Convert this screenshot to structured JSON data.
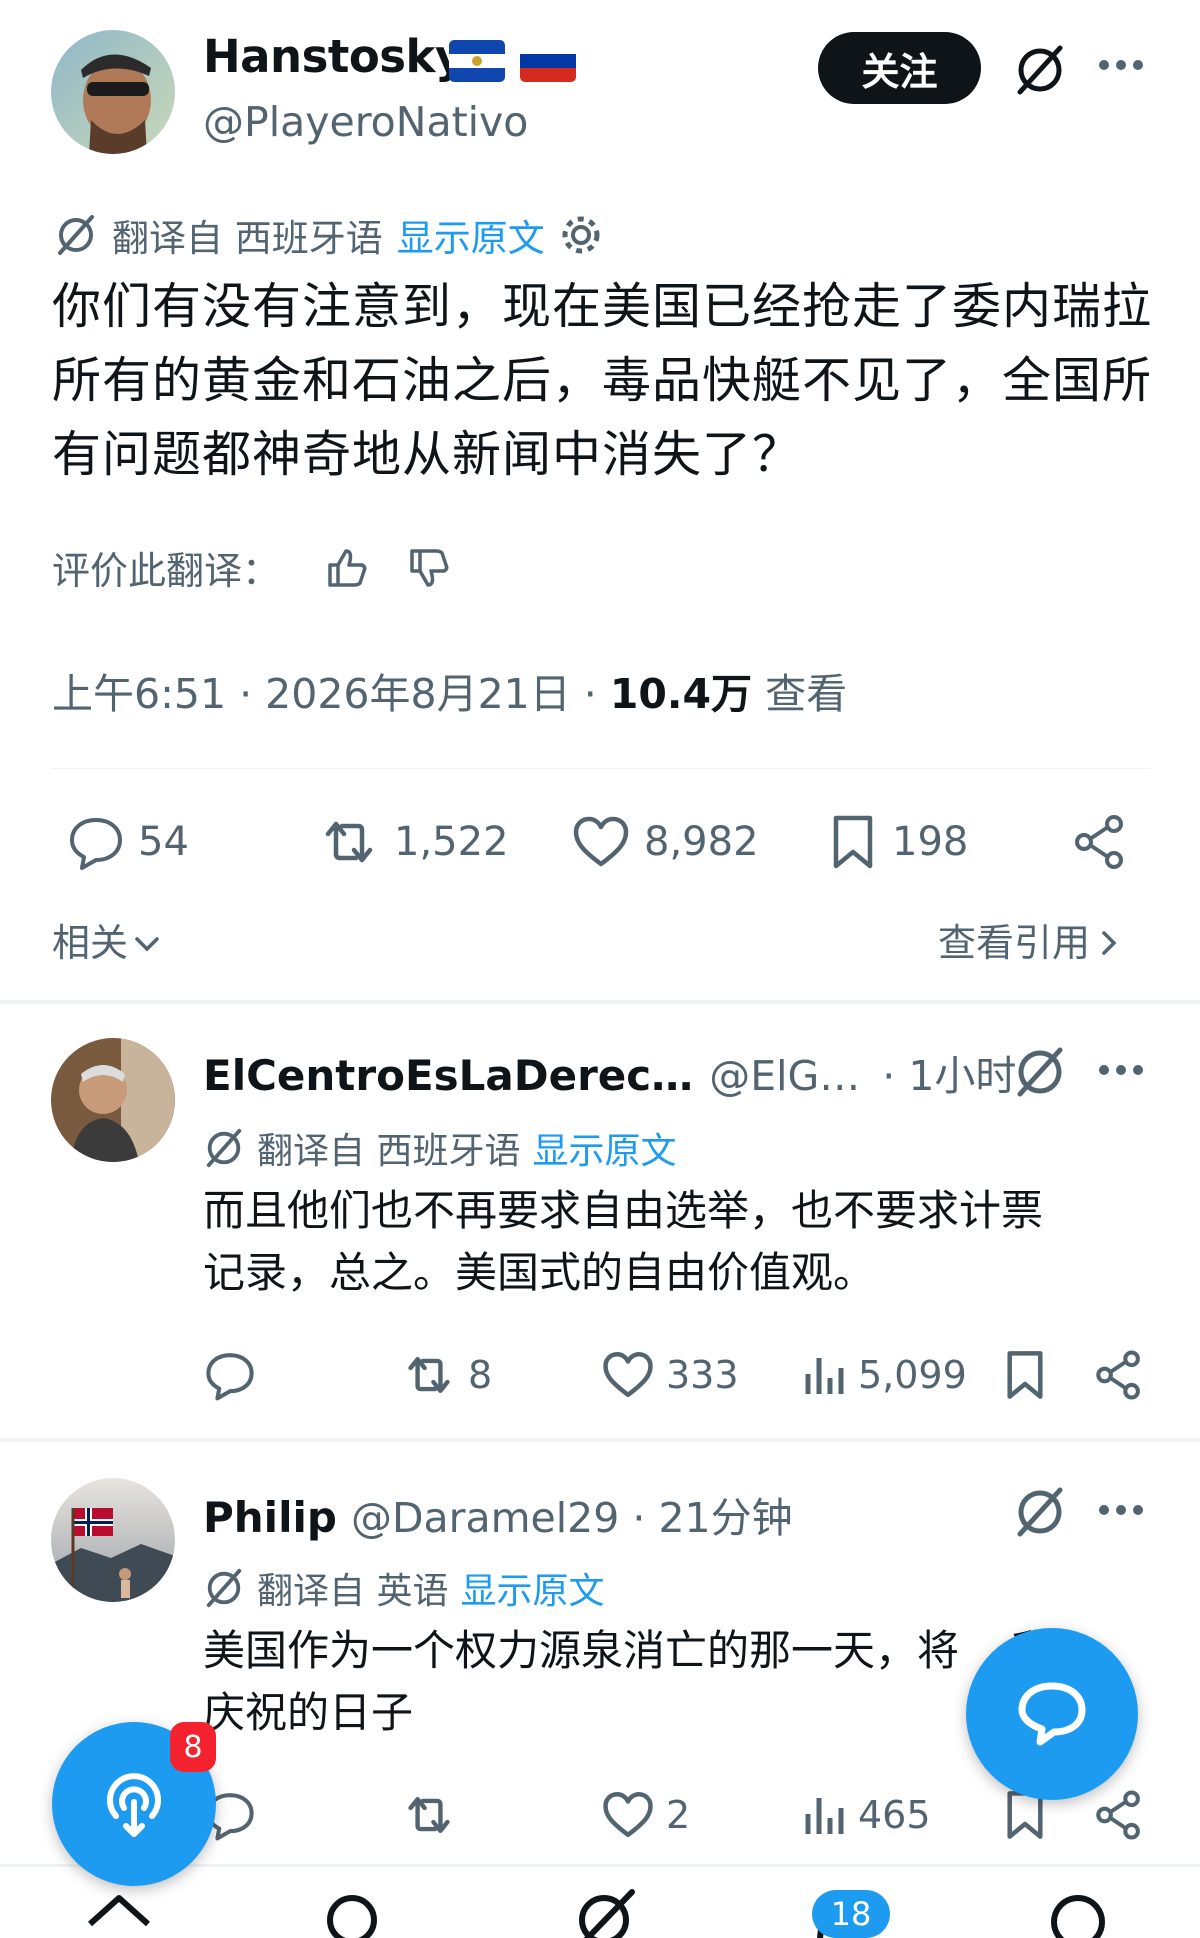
{
  "tweet": {
    "author_name": "Hanstosky",
    "author_handle": "@PlayeroNativo",
    "follow_label": "关注",
    "translate_prefix": "翻译自 西班牙语",
    "show_original": "显示原文",
    "text": "你们有没有注意到，现在美国已经抢走了委内瑞拉所有的黄金和石油之后，毒品快艇不见了，全国所有问题都神奇地从新闻中消失了？",
    "rate_label": "评价此翻译：",
    "time": "上午6:51 · 2026年8月21日 · ",
    "views_count": "10.4万",
    "views_label": " 查看",
    "stats": {
      "replies": "54",
      "reposts": "1,522",
      "likes": "8,982",
      "bookmarks": "198"
    },
    "related_label": "相关",
    "quotes_label": "查看引用"
  },
  "replies": [
    {
      "name": "ElCentroEsLaDerec…",
      "handle": "@ElG…",
      "time": "· 1小时",
      "translate_prefix": "翻译自 西班牙语",
      "show_original": "显示原文",
      "text_line1": "而且他们也不再要求自由选举，也不要求计票",
      "text_line2": "记录，总之。美国式的自由价值观。",
      "reposts": "8",
      "likes": "333",
      "views": "5,099"
    },
    {
      "name": "Philip",
      "handle": "@Daramel29 · 21分钟",
      "translate_prefix": "翻译自 英语",
      "show_original": "显示原文",
      "text_line1": "美国作为一个权力源泉消亡的那一天，将",
      "text_line1_tail": "我",
      "text_line2": "庆祝的日子",
      "likes": "2",
      "views": "465"
    }
  ],
  "floating": {
    "spaces_badge": "8",
    "nav_badge": "18"
  },
  "colors": {
    "accent": "#1d9bf0",
    "text": "#0f1419",
    "muted": "#536471",
    "badge": "#f4212e"
  },
  "icons": [
    "grok-icon",
    "more-icon",
    "gear-icon",
    "thumb-up-icon",
    "thumb-down-icon",
    "reply-icon",
    "repost-icon",
    "like-icon",
    "bookmark-icon",
    "share-icon",
    "views-icon",
    "chevron-down-icon",
    "chevron-right-icon",
    "chat-icon",
    "spaces-icon",
    "flag-el-salvador-icon",
    "flag-russia-icon"
  ]
}
